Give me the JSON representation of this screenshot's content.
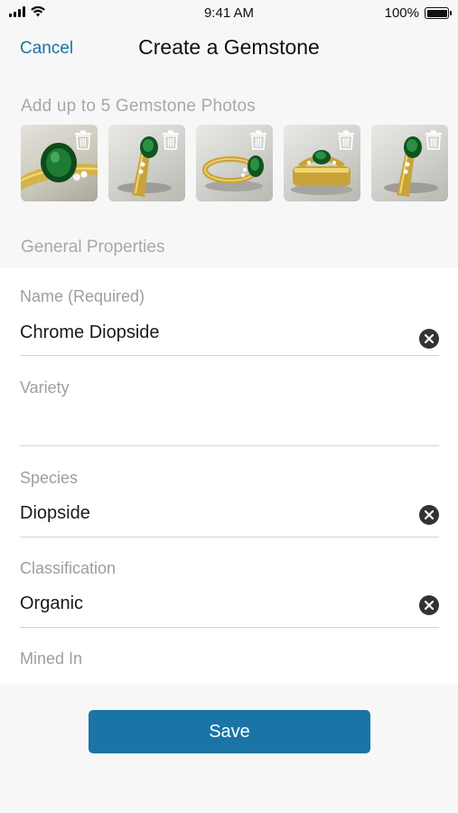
{
  "status_bar": {
    "time": "9:41 AM",
    "battery_text": "100%",
    "icons": [
      "signal-icon",
      "wifi-icon",
      "battery-icon"
    ]
  },
  "nav": {
    "cancel_label": "Cancel",
    "title": "Create a Gemstone"
  },
  "photos": {
    "label": "Add up to 5 Gemstone Photos",
    "items": [
      {
        "name": "gemstone-photo-1",
        "delete_icon": "trash-icon"
      },
      {
        "name": "gemstone-photo-2",
        "delete_icon": "trash-icon"
      },
      {
        "name": "gemstone-photo-3",
        "delete_icon": "trash-icon"
      },
      {
        "name": "gemstone-photo-4",
        "delete_icon": "trash-icon"
      },
      {
        "name": "gemstone-photo-5",
        "delete_icon": "trash-icon"
      }
    ]
  },
  "general_properties": {
    "section_label": "General Properties",
    "fields": {
      "name": {
        "label": "Name (Required)",
        "value": "Chrome Diopside",
        "clear_icon": "clear-icon"
      },
      "variety": {
        "label": "Variety",
        "value": ""
      },
      "species": {
        "label": "Species",
        "value": "Diopside",
        "clear_icon": "clear-icon"
      },
      "classification": {
        "label": "Classification",
        "value": "Organic",
        "clear_icon": "clear-icon"
      },
      "mined_in": {
        "label": "Mined In",
        "value": ""
      }
    }
  },
  "save_label": "Save",
  "colors": {
    "accent": "#1a74a6",
    "background": "#f7f7f7",
    "form_background": "#ffffff",
    "muted_label": "#a8a8a8"
  }
}
